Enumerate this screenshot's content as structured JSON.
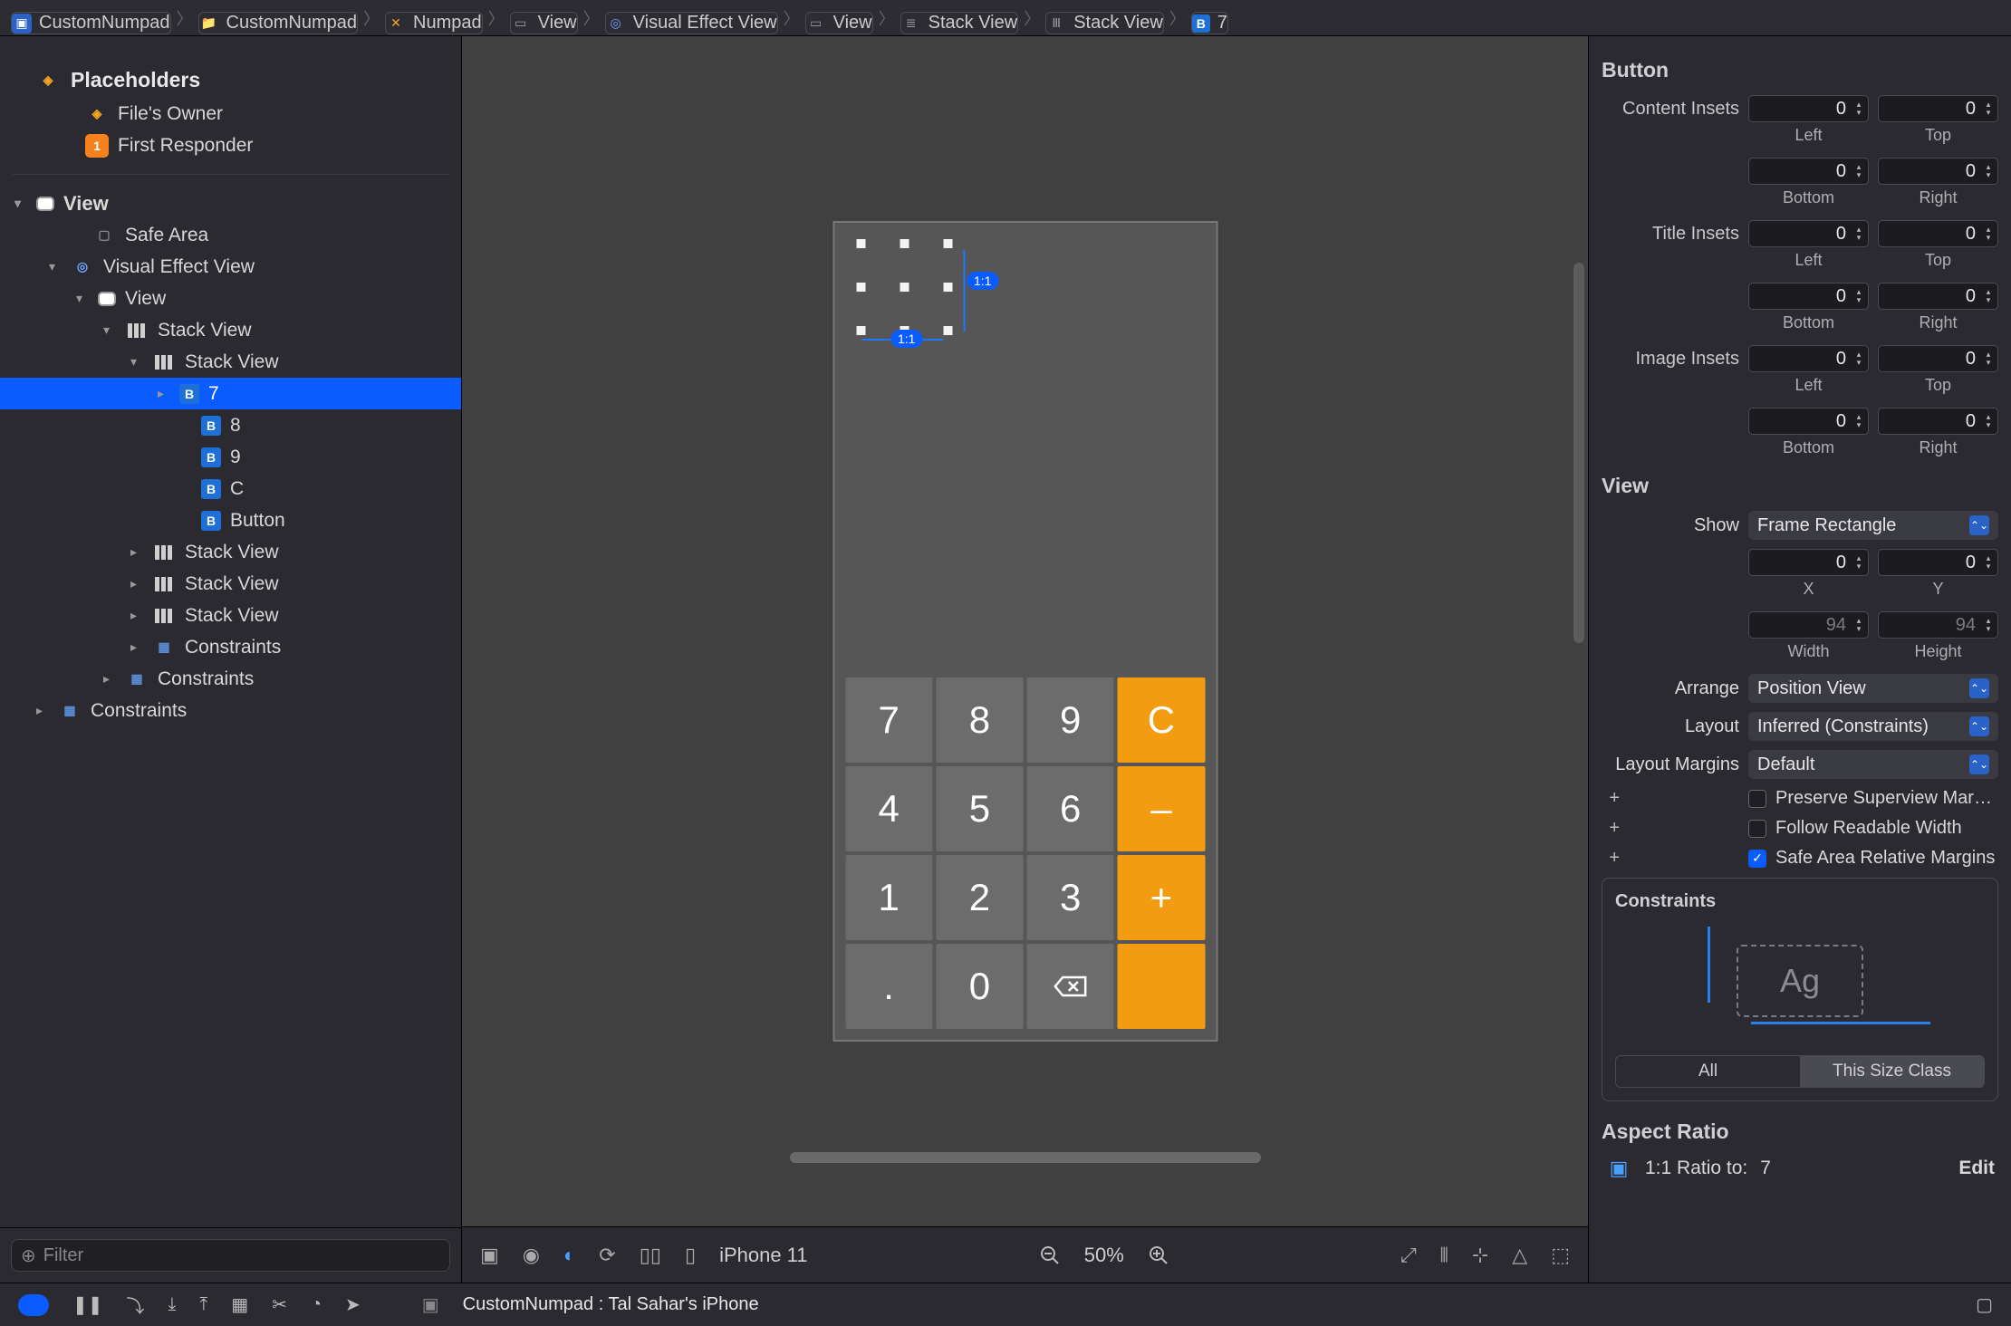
{
  "breadcrumb": [
    {
      "icon": "app",
      "label": "CustomNumpad"
    },
    {
      "icon": "folder",
      "label": "CustomNumpad"
    },
    {
      "icon": "xib",
      "label": "Numpad"
    },
    {
      "icon": "view",
      "label": "View"
    },
    {
      "icon": "vev",
      "label": "Visual Effect View"
    },
    {
      "icon": "view",
      "label": "View"
    },
    {
      "icon": "stack",
      "label": "Stack View"
    },
    {
      "icon": "stack",
      "label": "Stack View"
    },
    {
      "icon": "b",
      "label": "7"
    }
  ],
  "outline": {
    "placeholders_header": "Placeholders",
    "filter_placeholder": "Filter",
    "rows": [
      {
        "tri": "",
        "ind": 70,
        "ic": "cube",
        "label": "File's Owner"
      },
      {
        "tri": "",
        "ind": 70,
        "ic": "one",
        "iconText": "1",
        "label": "First Responder"
      },
      {
        "divider": true
      },
      {
        "tri": "down",
        "ind": 16,
        "ic": "vw",
        "label": "View",
        "header": true
      },
      {
        "tri": "",
        "ind": 78,
        "ic": "sa",
        "label": "Safe Area"
      },
      {
        "tri": "down",
        "ind": 54,
        "ic": "vev",
        "label": "Visual Effect View"
      },
      {
        "tri": "down",
        "ind": 84,
        "ic": "vw",
        "label": "View"
      },
      {
        "tri": "down",
        "ind": 114,
        "ic": "stk",
        "label": "Stack View"
      },
      {
        "tri": "down",
        "ind": 144,
        "ic": "stk",
        "label": "Stack View"
      },
      {
        "tri": "right",
        "ind": 174,
        "ic": "btn",
        "iconText": "B",
        "label": "7",
        "selected": true
      },
      {
        "tri": "",
        "ind": 198,
        "ic": "btn",
        "iconText": "B",
        "label": "8"
      },
      {
        "tri": "",
        "ind": 198,
        "ic": "btn",
        "iconText": "B",
        "label": "9"
      },
      {
        "tri": "",
        "ind": 198,
        "ic": "btn",
        "iconText": "B",
        "label": "C"
      },
      {
        "tri": "",
        "ind": 198,
        "ic": "btn",
        "iconText": "B",
        "label": "Button"
      },
      {
        "tri": "right",
        "ind": 144,
        "ic": "stk",
        "label": "Stack View"
      },
      {
        "tri": "right",
        "ind": 144,
        "ic": "stk",
        "label": "Stack View"
      },
      {
        "tri": "right",
        "ind": 144,
        "ic": "stk",
        "label": "Stack View"
      },
      {
        "tri": "right",
        "ind": 144,
        "ic": "con",
        "label": "Constraints"
      },
      {
        "tri": "right",
        "ind": 114,
        "ic": "con",
        "label": "Constraints"
      },
      {
        "tri": "right",
        "ind": 40,
        "ic": "con",
        "label": "Constraints"
      }
    ]
  },
  "canvas": {
    "ratio_badge": "1:1",
    "toolbar": {
      "device": "iPhone 11",
      "zoom": "50%"
    },
    "keys": [
      {
        "t": "7"
      },
      {
        "t": "8"
      },
      {
        "t": "9"
      },
      {
        "t": "C",
        "op": true
      },
      {
        "t": "4"
      },
      {
        "t": "5"
      },
      {
        "t": "6"
      },
      {
        "t": "–",
        "op": true
      },
      {
        "t": "1"
      },
      {
        "t": "2"
      },
      {
        "t": "3"
      },
      {
        "t": "+",
        "op": true
      },
      {
        "t": "."
      },
      {
        "t": "0"
      },
      {
        "t": "⌫"
      },
      {
        "t": "",
        "op": true
      }
    ]
  },
  "inspector": {
    "button_section": "Button",
    "content_insets_label": "Content Insets",
    "title_insets_label": "Title Insets",
    "image_insets_label": "Image Insets",
    "insets": {
      "content": {
        "left": "0",
        "top": "0",
        "bottom": "0",
        "right": "0"
      },
      "title": {
        "left": "0",
        "top": "0",
        "bottom": "0",
        "right": "0"
      },
      "image": {
        "left": "0",
        "top": "0",
        "bottom": "0",
        "right": "0"
      }
    },
    "sub": {
      "left": "Left",
      "top": "Top",
      "bottom": "Bottom",
      "right": "Right"
    },
    "view_section": "View",
    "show_label": "Show",
    "show_value": "Frame Rectangle",
    "xy": {
      "x": "0",
      "y": "0",
      "xl": "X",
      "yl": "Y"
    },
    "wh": {
      "w": "94",
      "h": "94",
      "wl": "Width",
      "hl": "Height"
    },
    "arrange_label": "Arrange",
    "arrange_value": "Position View",
    "layout_label": "Layout",
    "layout_value": "Inferred (Constraints)",
    "margins_label": "Layout Margins",
    "margins_value": "Default",
    "preserve": "Preserve Superview Mar…",
    "readable": "Follow Readable Width",
    "safearea": "Safe Area Relative Margins",
    "constraints_title": "Constraints",
    "seg_all": "All",
    "seg_this": "This Size Class",
    "ag": "Ag",
    "aspect_title": "Aspect Ratio",
    "aspect_ratio": "1:1 Ratio to:",
    "aspect_target": "7",
    "edit": "Edit"
  },
  "bottom": {
    "target": "CustomNumpad : Tal Sahar's iPhone"
  }
}
